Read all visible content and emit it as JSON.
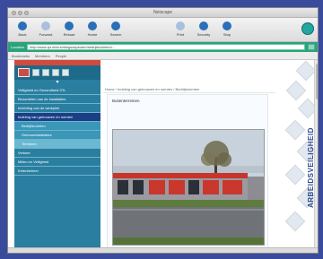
{
  "window": {
    "title": "Netscape"
  },
  "toolbar": {
    "buttons": [
      {
        "label": "Back",
        "icon": "back-arrow-icon"
      },
      {
        "label": "Forward",
        "icon": "forward-arrow-icon"
      },
      {
        "label": "Reload",
        "icon": "reload-icon"
      },
      {
        "label": "Home",
        "icon": "home-icon"
      },
      {
        "label": "Search",
        "icon": "search-icon"
      },
      {
        "label": "Print",
        "icon": "print-icon"
      },
      {
        "label": "Security",
        "icon": "lock-icon"
      },
      {
        "label": "Stop",
        "icon": "stop-icon"
      }
    ]
  },
  "addressbar": {
    "label": "Location",
    "url": "http://www.ipr.nl/inrichtingsaspecten/bedrijfsruimten/..."
  },
  "favbar": {
    "items": [
      "Bookmarks",
      "Members",
      "People"
    ]
  },
  "nav": {
    "items": [
      {
        "label": "Veiligheid en Gezondheid ITIL",
        "style": "normal"
      },
      {
        "label": "Beoordelen van de installaties",
        "style": "normal"
      },
      {
        "label": "Inrichting van de werkplek",
        "style": "normal"
      },
      {
        "label": "Indeling van gebouwen en ruimten",
        "style": "active"
      },
      {
        "label": "Bedrijfsruimten",
        "style": "sub"
      },
      {
        "label": "Gebouwinstallaties",
        "style": "sub"
      },
      {
        "label": "Terreinen",
        "style": "sub"
      },
      {
        "label": "Verkeer",
        "style": "normal"
      },
      {
        "label": "Milieu en Veiligheid",
        "style": "normal"
      },
      {
        "label": "Ketenbeheer",
        "style": "normal"
      }
    ]
  },
  "breadcrumb": "Home / Indeling van gebouwen en ruimten / Bedrijfsruimten",
  "main": {
    "section_title": "Buitenterreinen"
  },
  "deco": {
    "vertical_text": "ARBEIDSVEILIGHEID"
  },
  "status": {
    "text": ""
  },
  "colors": {
    "frame_bg": "#3a4a9c",
    "nav_bg": "#2a7fa0",
    "nav_active": "#1b3f86",
    "accent_red": "#d24a3c",
    "address_green": "#2aa37d"
  }
}
